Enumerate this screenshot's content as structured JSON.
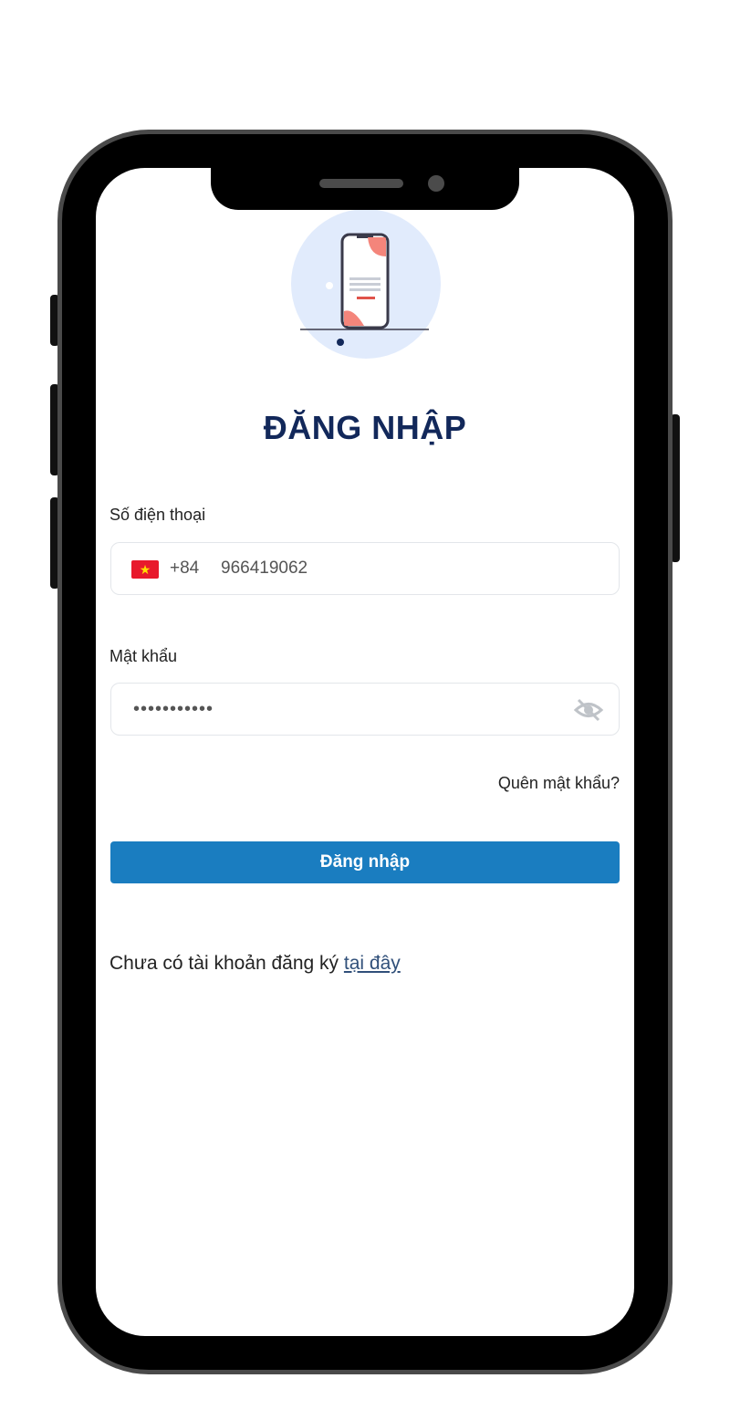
{
  "login": {
    "title": "ĐĂNG NHẬP",
    "phone_label": "Số điện thoại",
    "country_code": "+84",
    "phone_value": "966419062",
    "password_label": "Mật khẩu",
    "password_value": "•••••••••••",
    "forgot_link": "Quên mật khẩu?",
    "submit_label": "Đăng nhập",
    "register_text": "Chưa có tài khoản đăng ký",
    "register_link": "tại đây"
  },
  "icons": {
    "flag": "vietnam-flag-icon",
    "toggle_password": "eye-slash-icon"
  },
  "colors": {
    "title": "#12285a",
    "primary_button": "#1a7dc0",
    "flag_red": "#e8192c",
    "flag_star": "#ffde00",
    "link": "#31507a"
  }
}
